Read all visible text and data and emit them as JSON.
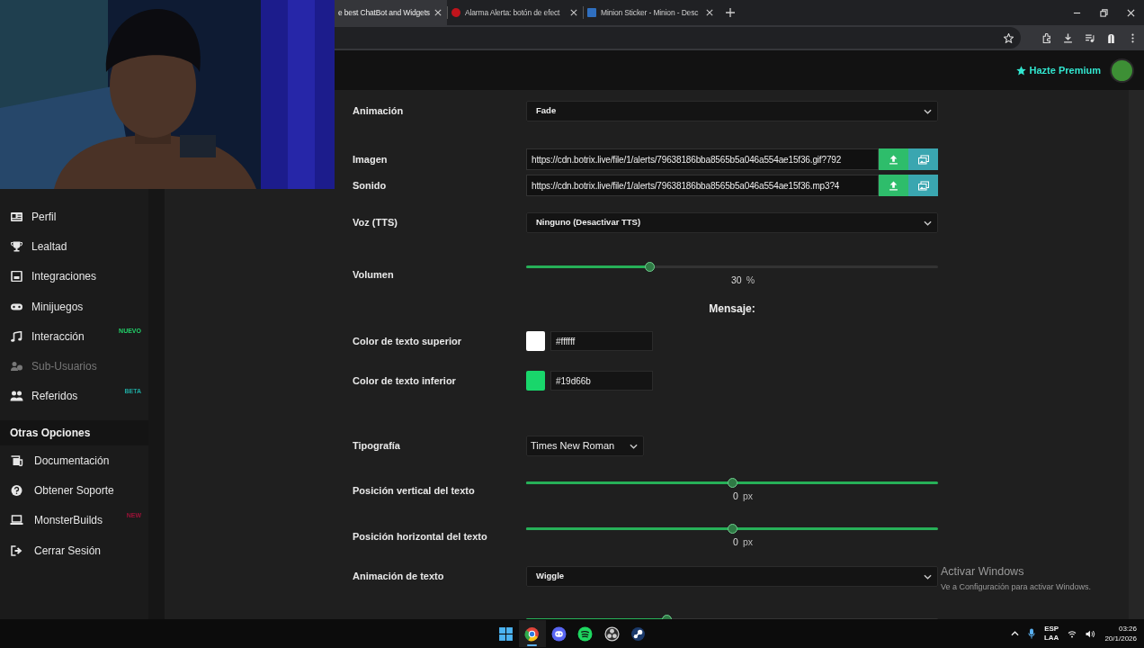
{
  "browser": {
    "tabs": [
      {
        "title": "e best ChatBot and Widgets",
        "selected": true
      },
      {
        "title": "Alarma Alerta: botón de efect",
        "selected": false
      },
      {
        "title": "Minion Sticker - Minion - Desc",
        "selected": false
      }
    ]
  },
  "header": {
    "premium_label": "Hazte Premium"
  },
  "sidebar": {
    "items": [
      {
        "label": "Perfil",
        "disabled": false
      },
      {
        "label": "Lealtad",
        "disabled": false
      },
      {
        "label": "Integraciones",
        "disabled": false
      },
      {
        "label": "Minijuegos",
        "disabled": false
      },
      {
        "label": "Interacción",
        "disabled": false,
        "badge": {
          "text": "NUEVO",
          "color": "#22d36a"
        }
      },
      {
        "label": "Sub-Usuarios",
        "disabled": true
      },
      {
        "label": "Referidos",
        "disabled": false,
        "badge": {
          "text": "BETA",
          "color": "#1fa8a0"
        }
      }
    ],
    "section_title": "Otras Opciones",
    "section_items": [
      {
        "label": "Documentación"
      },
      {
        "label": "Obtener Soporte"
      },
      {
        "label": "MonsterBuilds",
        "badge": {
          "text": "NEW",
          "color": "#9c1238"
        }
      },
      {
        "label": "Cerrar Sesión"
      }
    ]
  },
  "form": [
    {
      "kind": "select",
      "label": "Animación",
      "value": "Fade"
    },
    {
      "kind": "url",
      "label": "Imagen",
      "value": "https://cdn.botrix.live/file/1/alerts/79638186bba8565b5a046a554ae15f36.gif?792"
    },
    {
      "kind": "url",
      "label": "Sonido",
      "value": "https://cdn.botrix.live/file/1/alerts/79638186bba8565b5a046a554ae15f36.mp3?4"
    },
    {
      "kind": "select",
      "label": "Voz (TTS)",
      "value": "Ninguno (Desactivar TTS)"
    },
    {
      "kind": "slider",
      "label": "Volumen",
      "level": 0.3,
      "value": "30",
      "unit": "%",
      "full_track": false
    },
    {
      "kind": "heading",
      "text": "Mensaje:"
    },
    {
      "kind": "color",
      "label": "Color de texto superior",
      "color": "#ffffff",
      "value": "#ffffff"
    },
    {
      "kind": "color",
      "label": "Color de texto inferior",
      "color": "#19d66b",
      "value": "#19d66b"
    },
    {
      "kind": "font",
      "label": "Tipografía",
      "value": "Times New Roman"
    },
    {
      "kind": "slider",
      "label": "Posición vertical del texto",
      "level": 0.5,
      "value": "0",
      "unit": "px",
      "full_track": true
    },
    {
      "kind": "slider",
      "label": "Posición horizontal del texto",
      "level": 0.5,
      "value": "0",
      "unit": "px",
      "full_track": true
    },
    {
      "kind": "select",
      "label": "Animación de texto",
      "value": "Wiggle"
    },
    {
      "kind": "slider",
      "level": 0.34,
      "full_track": false
    }
  ],
  "windows_notice": {
    "title": "Activar Windows",
    "text": "Ve a Configuración para activar Windows."
  },
  "taskbar": {
    "apps": [
      {
        "selected": false
      },
      {
        "selected": true
      },
      {
        "selected": false
      },
      {
        "selected": false
      },
      {
        "selected": false
      },
      {
        "selected": false
      }
    ],
    "language": "ESP",
    "layout": "LAA",
    "time": "03:26",
    "date": "20/1/2026"
  }
}
